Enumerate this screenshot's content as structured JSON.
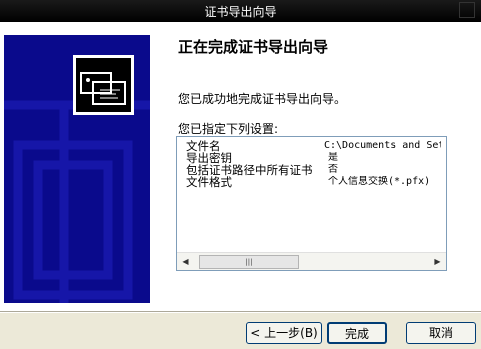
{
  "window": {
    "title": "证书导出向导"
  },
  "heading": "正在完成证书导出向导",
  "message": "您已成功地完成证书导出向导。",
  "settings_label": "您已指定下列设置:",
  "settings": [
    {
      "key": "文件名",
      "value": "C:\\Documents and Set"
    },
    {
      "key": "导出密钥",
      "value": "是"
    },
    {
      "key": "包括证书路径中所有证书",
      "value": "否"
    },
    {
      "key": "文件格式",
      "value": "个人信息交换(*.pfx)"
    }
  ],
  "buttons": {
    "back": "< 上一步(B)",
    "finish": "完成",
    "cancel": "取消"
  },
  "icons": {
    "banner": "certificate-icon",
    "scroll_left": "arrow-left-icon",
    "scroll_right": "arrow-right-icon",
    "thumb": "grip-icon"
  },
  "colors": {
    "banner": "#0a0a8c",
    "titlebar": "#000000",
    "dialog": "#ece9d8"
  }
}
